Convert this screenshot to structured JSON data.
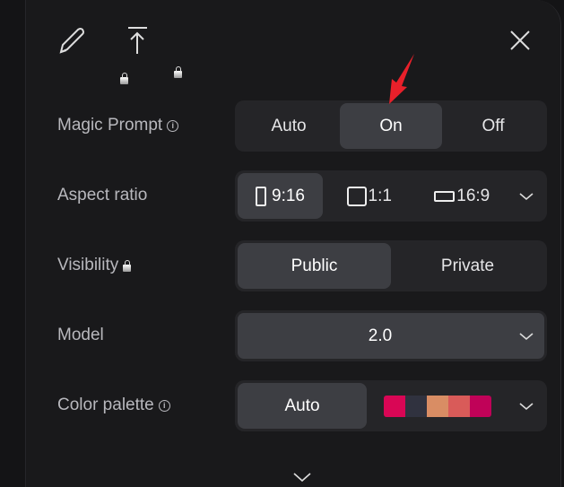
{
  "toolbar": {
    "edit_icon": "pencil-lock-icon",
    "upload_icon": "upload-lock-icon",
    "close_icon": "close-icon"
  },
  "magic_prompt": {
    "label": "Magic Prompt",
    "options": [
      "Auto",
      "On",
      "Off"
    ],
    "selected": "On"
  },
  "aspect_ratio": {
    "label": "Aspect ratio",
    "options": [
      "9:16",
      "1:1",
      "16:9"
    ],
    "selected": "9:16"
  },
  "visibility": {
    "label": "Visibility",
    "options": [
      "Public",
      "Private"
    ],
    "selected": "Public"
  },
  "model": {
    "label": "Model",
    "value": "2.0"
  },
  "color_palette": {
    "label": "Color palette",
    "selected": "Auto",
    "swatches": [
      "#d90655",
      "#30323f",
      "#d98d64",
      "#d95b59",
      "#c00258"
    ]
  },
  "annotation": {
    "arrow_color": "#e8202a"
  }
}
